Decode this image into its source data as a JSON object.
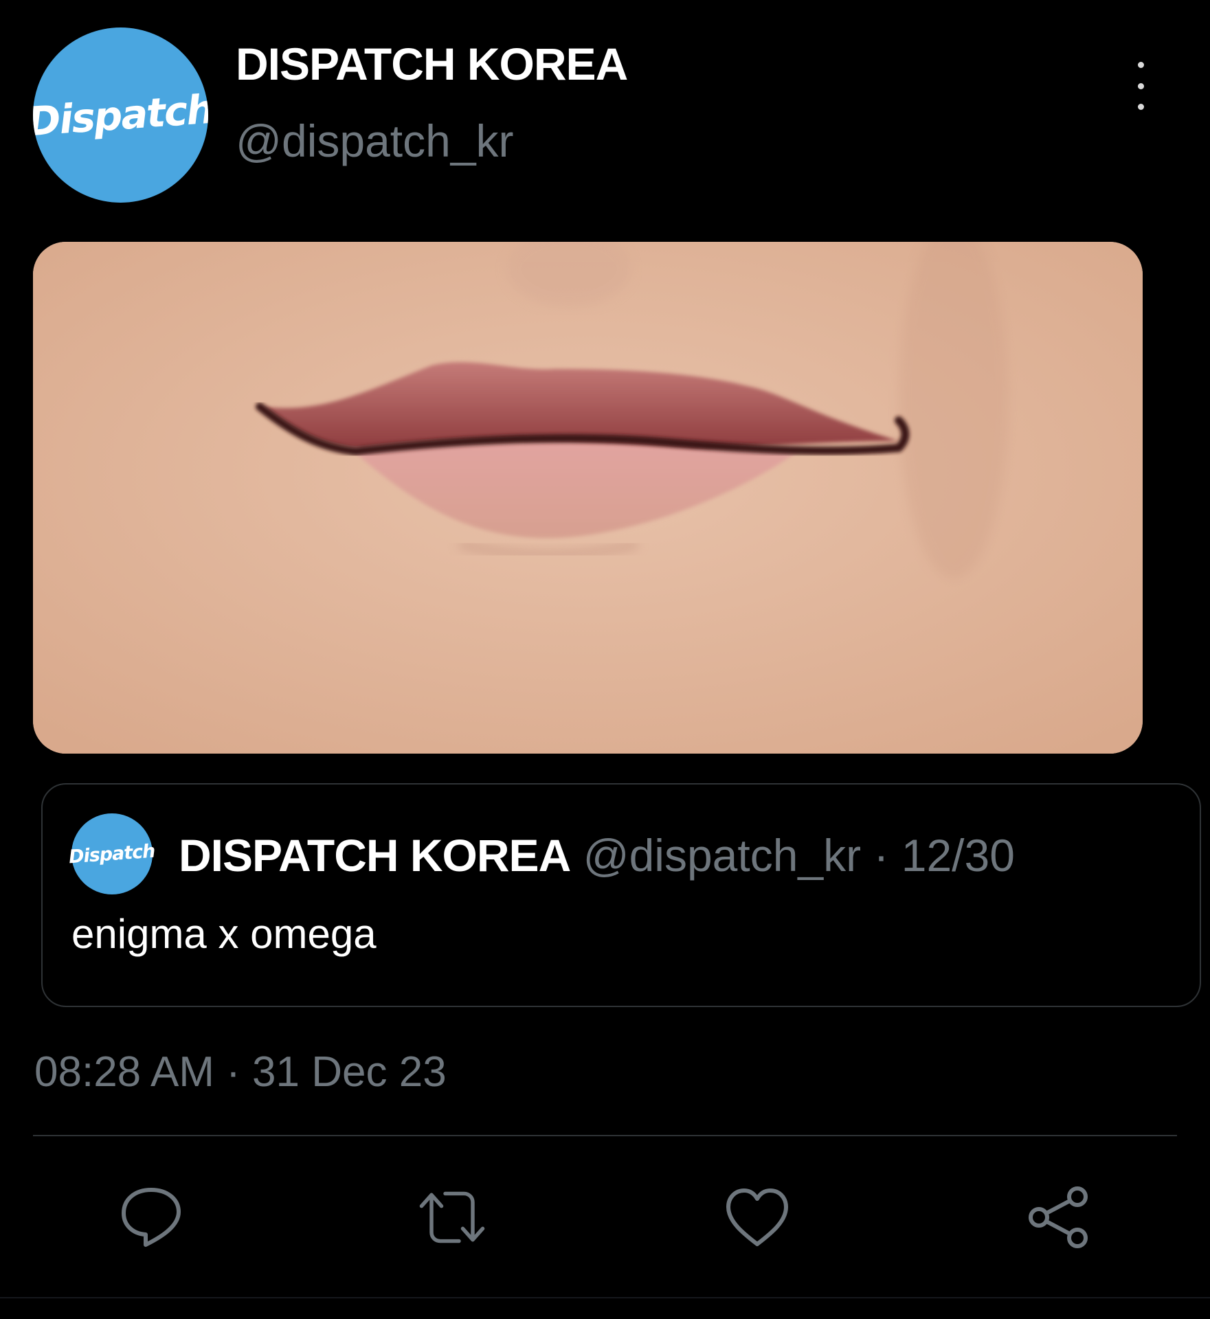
{
  "tweet": {
    "avatar_logo": "Dispatch",
    "display_name": "DISPATCH KOREA",
    "handle": "@dispatch_kr",
    "more_icon": "more-vertical-icon",
    "media_description_icon": "photo"
  },
  "quote": {
    "avatar_logo": "Dispatch",
    "display_name": "DISPATCH KOREA",
    "handle_date": "@dispatch_kr · 12/30",
    "text": "enigma x omega"
  },
  "timestamp": "08:28 AM · 31 Dec 23",
  "actions": [
    {
      "icon": "reply-icon"
    },
    {
      "icon": "retweet-icon"
    },
    {
      "icon": "like-icon"
    },
    {
      "icon": "share-icon"
    }
  ],
  "colors": {
    "background": "#000000",
    "avatar_blue": "#4aa6e0",
    "muted_text": "#6e767d",
    "border": "#2f3336"
  }
}
